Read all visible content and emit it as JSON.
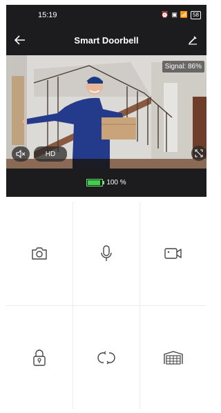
{
  "status_bar": {
    "time": "15:19",
    "battery": "58"
  },
  "header": {
    "title": "Smart Doorbell"
  },
  "video": {
    "signal": "Signal: 86%",
    "quality": "HD"
  },
  "battery": {
    "level_text": "100 %",
    "level": 1.0,
    "color": "#3bd34a"
  },
  "actions": [
    {
      "icon": "camera-icon"
    },
    {
      "icon": "microphone-icon"
    },
    {
      "icon": "video-record-icon"
    },
    {
      "icon": "lock-icon"
    },
    {
      "icon": "refresh-icon"
    },
    {
      "icon": "gate-icon"
    }
  ]
}
